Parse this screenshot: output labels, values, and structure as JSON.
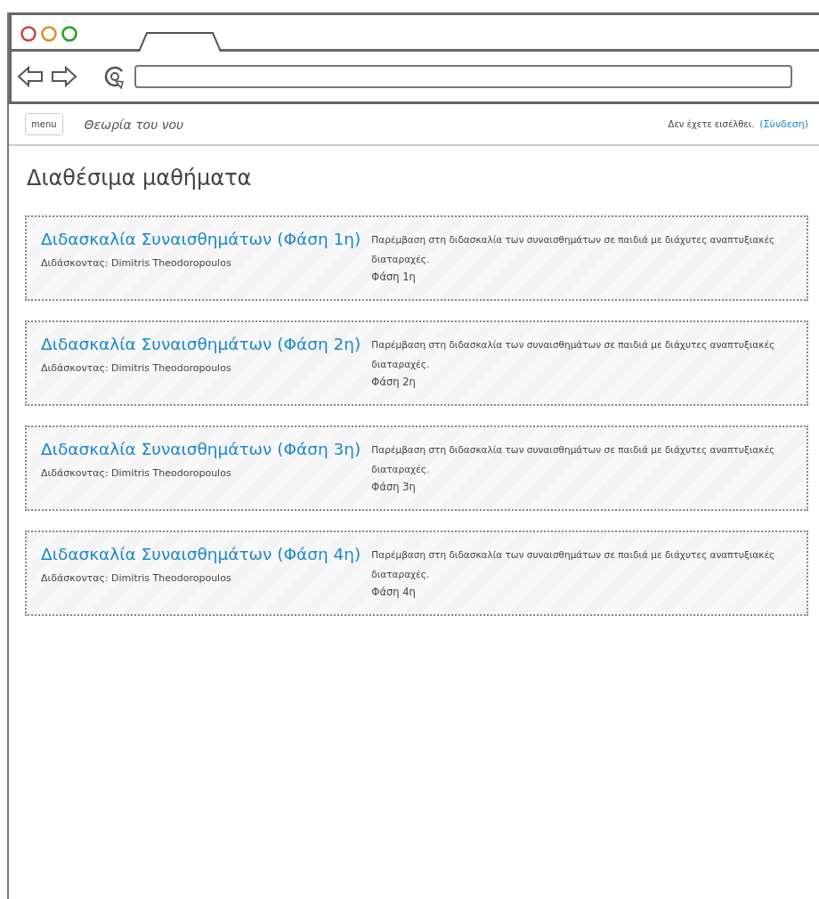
{
  "header": {
    "menu_button": "menu",
    "site_title": "Θεωρία του νου",
    "login_notice": "Δεν έχετε εισέλθει.",
    "login_link": "(Σύνδεση)"
  },
  "page_title": "Διαθέσιμα μαθήματα",
  "courses": [
    {
      "title": "Διδασκαλία Συναισθημάτων (Φάση 1η)",
      "teacher": "Διδάσκοντας: Dimitris Theodoropoulos",
      "description": "Παρέμβαση στη διδασκαλία των συναισθημάτων σε παιδιά με διάχυτες αναπτυξιακές διαταραχές.",
      "phase": "Φάση 1η"
    },
    {
      "title": "Διδασκαλία Συναισθημάτων (Φάση 2η)",
      "teacher": "Διδάσκοντας: Dimitris Theodoropoulos",
      "description": "Παρέμβαση στη διδασκαλία των συναισθημάτων σε παιδιά με διάχυτες αναπτυξιακές διαταραχές.",
      "phase": "Φάση 2η"
    },
    {
      "title": "Διδασκαλία Συναισθημάτων (Φάση 3η)",
      "teacher": "Διδάσκοντας: Dimitris Theodoropoulos",
      "description": "Παρέμβαση στη διδασκαλία των συναισθημάτων σε παιδιά με διάχυτες αναπτυξιακές διαταραχές.",
      "phase": "Φάση 3η"
    },
    {
      "title": "Διδασκαλία Συναισθημάτων (Φάση 4η)",
      "teacher": "Διδάσκοντας: Dimitris Theodoropoulos",
      "description": "Παρέμβαση στη διδασκαλία των συναισθημάτων σε παιδιά με διάχυτες αναπτυξιακές διαταραχές.",
      "phase": "Φάση 4η"
    }
  ]
}
